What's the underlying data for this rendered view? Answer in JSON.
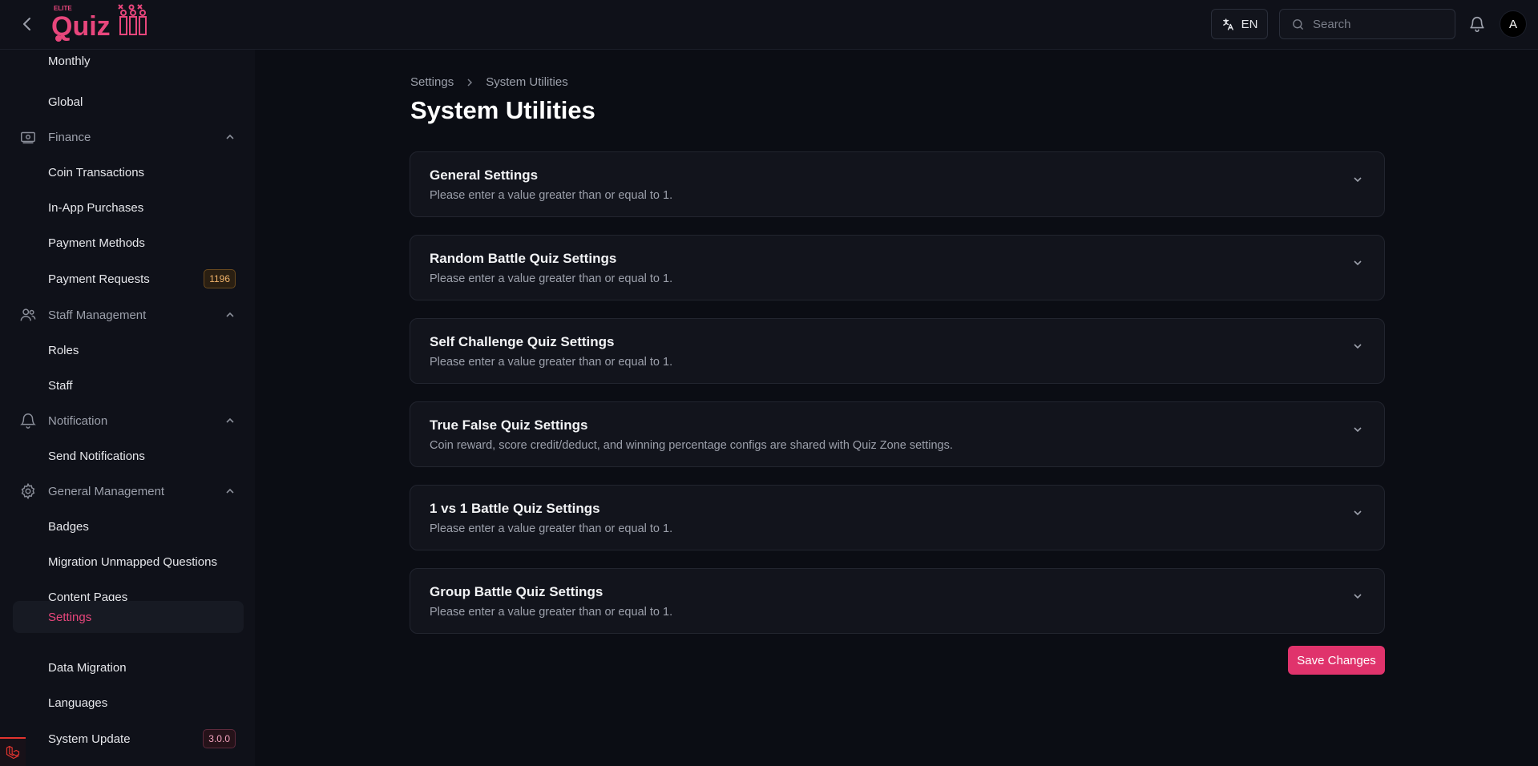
{
  "app": {
    "logo_text": "Quiz",
    "logo_subtext": "ELITE"
  },
  "topbar": {
    "language": "EN",
    "search_placeholder": "Search",
    "avatar_initial": "A"
  },
  "sidebar": {
    "items": [
      {
        "label": "Monthly",
        "type": "sub"
      },
      {
        "label": "Global",
        "type": "sub"
      },
      {
        "label": "Finance",
        "type": "group",
        "icon": "money-icon"
      },
      {
        "label": "Coin Transactions",
        "type": "sub"
      },
      {
        "label": "In-App Purchases",
        "type": "sub"
      },
      {
        "label": "Payment Methods",
        "type": "sub"
      },
      {
        "label": "Payment Requests",
        "type": "sub",
        "badge": "1196"
      },
      {
        "label": "Staff Management",
        "type": "group",
        "icon": "users-icon"
      },
      {
        "label": "Roles",
        "type": "sub"
      },
      {
        "label": "Staff",
        "type": "sub"
      },
      {
        "label": "Notification",
        "type": "group",
        "icon": "bell-icon"
      },
      {
        "label": "Send Notifications",
        "type": "sub"
      },
      {
        "label": "General Management",
        "type": "group",
        "icon": "gear-icon"
      },
      {
        "label": "Badges",
        "type": "sub"
      },
      {
        "label": "Migration Unmapped Questions",
        "type": "sub"
      },
      {
        "label": "Content Pages",
        "type": "sub"
      },
      {
        "label": "Settings",
        "type": "sub",
        "active": true
      },
      {
        "label": "Data Migration",
        "type": "sub"
      },
      {
        "label": "Languages",
        "type": "sub"
      },
      {
        "label": "System Update",
        "type": "sub",
        "badge": "3.0.0"
      }
    ]
  },
  "breadcrumb": [
    "Settings",
    "System Utilities"
  ],
  "page_title": "System Utilities",
  "sections": [
    {
      "title": "General Settings",
      "description": "Please enter a value greater than or equal to 1."
    },
    {
      "title": "Random Battle Quiz Settings",
      "description": "Please enter a value greater than or equal to 1."
    },
    {
      "title": "Self Challenge Quiz Settings",
      "description": "Please enter a value greater than or equal to 1."
    },
    {
      "title": "True False Quiz Settings",
      "description": "Coin reward, score credit/deduct, and winning percentage configs are shared with Quiz Zone settings."
    },
    {
      "title": "1 vs 1 Battle Quiz Settings",
      "description": "Please enter a value greater than or equal to 1."
    },
    {
      "title": "Group Battle Quiz Settings",
      "description": "Please enter a value greater than or equal to 1."
    }
  ],
  "save_label": "Save Changes",
  "colors": {
    "accent": "#e0336c",
    "background": "#0b0d14",
    "panel": "#12141c"
  }
}
